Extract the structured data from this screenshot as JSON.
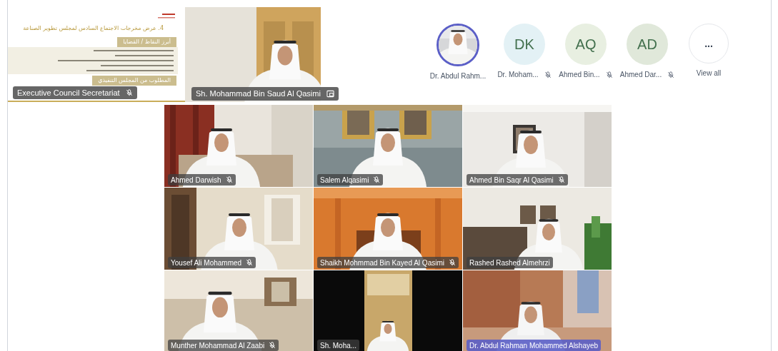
{
  "shared_screen": {
    "slide": {
      "title": "4. عرض مخرجات الاجتماع السادس لمجلس تطوير الصناعة",
      "sections": [
        "أبرز النقاط / القضايا",
        "المطلوب من المجلس التنفيذي"
      ]
    },
    "name": "Executive Council Secretariat",
    "muted": true
  },
  "spotlight": {
    "name": "Sh. Mohammad Bin Saud Al Qasimi",
    "pinned": true
  },
  "participants_strip": [
    {
      "name": "Dr. Abdul Rahm...",
      "speaking": true,
      "muted": false
    },
    {
      "kind": "initials",
      "initials": "DK",
      "color": "#e3f1f5",
      "name": "Dr. Moham...",
      "speaking": false,
      "muted": true
    },
    {
      "kind": "initials",
      "initials": "AQ",
      "color": "#e8efe1",
      "name": "Ahmed Bin...",
      "speaking": false,
      "muted": true
    },
    {
      "kind": "initials",
      "initials": "AD",
      "color": "#e0e8da",
      "name": "Ahmed Dar...",
      "speaking": false,
      "muted": true
    },
    {
      "kind": "more",
      "label": "...",
      "name": "View all"
    }
  ],
  "tiles": [
    {
      "name": "Ahmed Darwish",
      "muted": true,
      "active_speaker": false
    },
    {
      "name": "Salem Alqasimi",
      "muted": true,
      "active_speaker": false
    },
    {
      "name": "Ahmed Bin Saqr Al Qasimi",
      "muted": true,
      "active_speaker": false
    },
    {
      "name": "Yousef Ali Mohammed",
      "muted": true,
      "active_speaker": false
    },
    {
      "name": "Shaikh Mohmmad Bin Kayed Al Qasimi",
      "muted": true,
      "active_speaker": false
    },
    {
      "name": "Rashed Rashed Almehrzi",
      "muted": false,
      "active_speaker": false
    },
    {
      "name": "Munther Mohammad Al Zaabi",
      "muted": true,
      "active_speaker": false
    },
    {
      "name": "Sh. Moha...",
      "muted": false,
      "active_speaker": false
    },
    {
      "name": "Dr. Abdul Rahman Mohammed Alshayeb",
      "muted": false,
      "active_speaker": true
    }
  ]
}
